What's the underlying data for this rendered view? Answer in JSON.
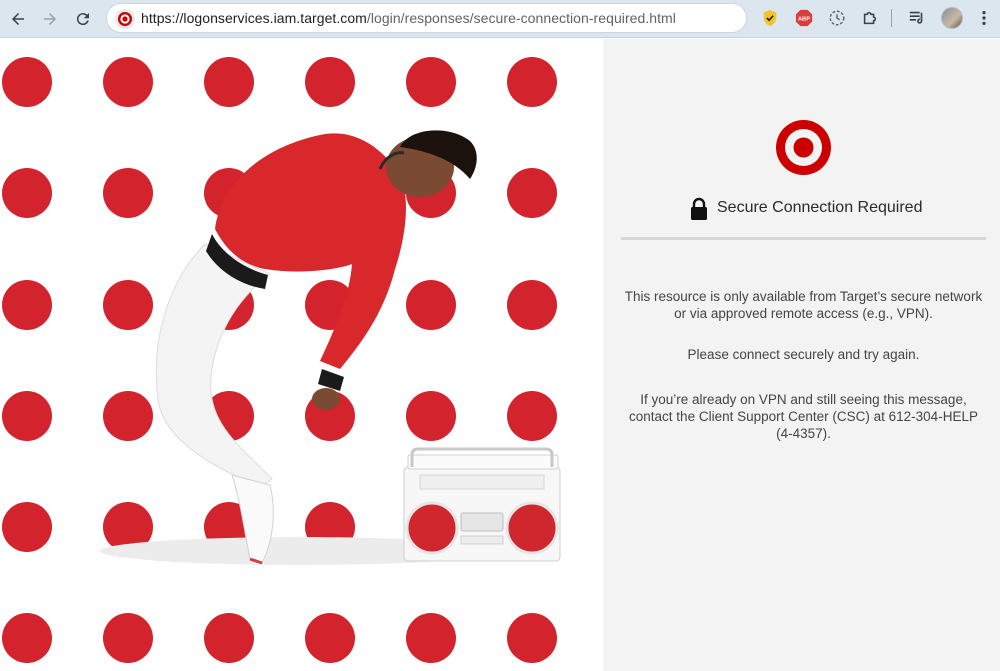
{
  "browser": {
    "url_host": "https://logonservices.iam.target.com",
    "url_path": "/login/responses/secure-connection-required.html",
    "extensions": [
      "norton-shield-icon",
      "adblock-icon",
      "sync-icon",
      "puzzle-icon",
      "media-queue-icon"
    ],
    "adblock_label": "ABP"
  },
  "panel": {
    "heading": "Secure Connection Required",
    "message_1": "This resource is only available from Target’s secure network or via approved remote access (e.g., VPN).",
    "message_2": "Please connect securely and try again.",
    "message_3": "If you’re already on VPN and still seeing this message, contact the Client Support Center (CSC) at 612-304-HELP (4-4357)."
  },
  "colors": {
    "brand_red": "#cc0000",
    "dot_red": "#d3232d",
    "panel_bg": "#f3f3f3",
    "toolbar_bg": "#dbe6ef"
  }
}
